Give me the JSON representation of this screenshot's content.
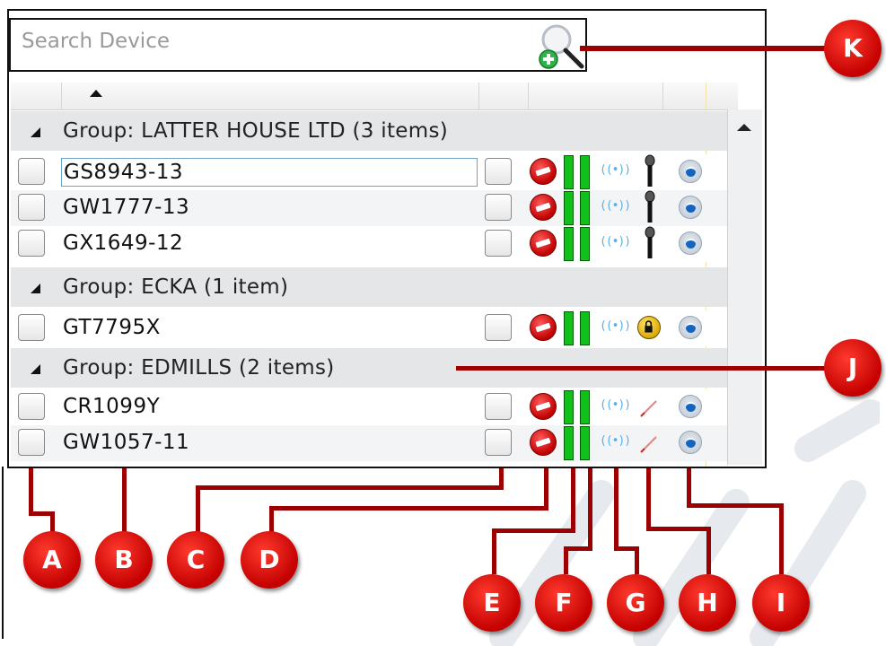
{
  "search": {
    "placeholder": "Search Device"
  },
  "groups": [
    {
      "label": "Group: LATTER HOUSE LTD (3 items)",
      "devices": [
        {
          "name": "GS8943-13",
          "status_icon": "microphone-icon"
        },
        {
          "name": "GW1777-13",
          "status_icon": "microphone-icon"
        },
        {
          "name": "GX1649-12",
          "status_icon": "microphone-icon"
        }
      ]
    },
    {
      "label": "Group: ECKA (1 item)",
      "devices": [
        {
          "name": "GT7795X",
          "status_icon": "lock-icon"
        }
      ]
    },
    {
      "label": "Group: EDMILLS (2 items)",
      "devices": [
        {
          "name": "CR1099Y",
          "status_icon": "pencil-icon"
        },
        {
          "name": "GW1057-11",
          "status_icon": "pencil-icon"
        }
      ]
    }
  ],
  "row_icons": {
    "wifi_glyph": "((•))",
    "no_entry": "no-entry-icon",
    "signal": "signal-bars-icon",
    "power": "power-icon"
  },
  "callouts": {
    "a": "A",
    "b": "B",
    "c": "C",
    "d": "D",
    "e": "E",
    "f": "F",
    "g": "G",
    "h": "H",
    "i": "I",
    "j": "J",
    "k": "K"
  },
  "colors": {
    "callout": "#c40000",
    "signal_bar": "#0fc21a",
    "group_bg": "#e4e6e8"
  }
}
